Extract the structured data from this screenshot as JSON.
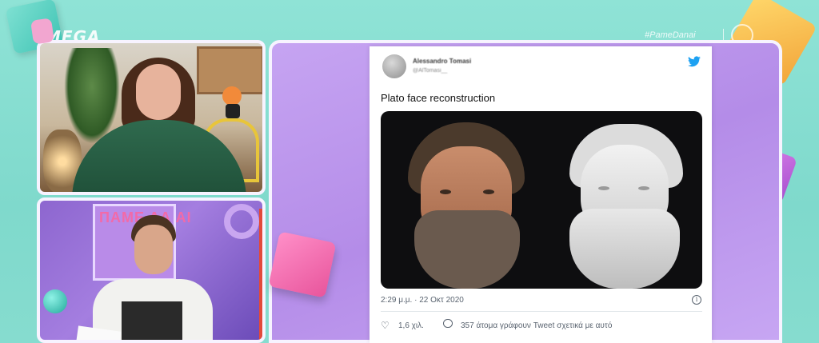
{
  "channel": {
    "logo": "MEGA",
    "hashtag": "#PameDanai"
  },
  "studio": {
    "panel_text": "ΠΑΜΕ ΔΑ ΑΙ"
  },
  "tweet": {
    "author_name": "Alessandro Tomasi",
    "author_handle": "@AlTomasi__",
    "text": "Plato face reconstruction",
    "timestamp": "2:29 μ.μ. · 22 Οκτ 2020",
    "likes": "1,6 χιλ.",
    "replies": "357 άτομα γράφουν Tweet σχετικά με αυτό",
    "info_glyph": "i"
  },
  "colors": {
    "background": "#8fe3d6",
    "tweet_bg": "#ffffff",
    "twitter_blue": "#1da1f2",
    "frame_purple": "#b48ce8"
  },
  "icons": [
    "twitter-bird-icon",
    "info-icon",
    "heart-icon",
    "reply-bubble-icon"
  ]
}
